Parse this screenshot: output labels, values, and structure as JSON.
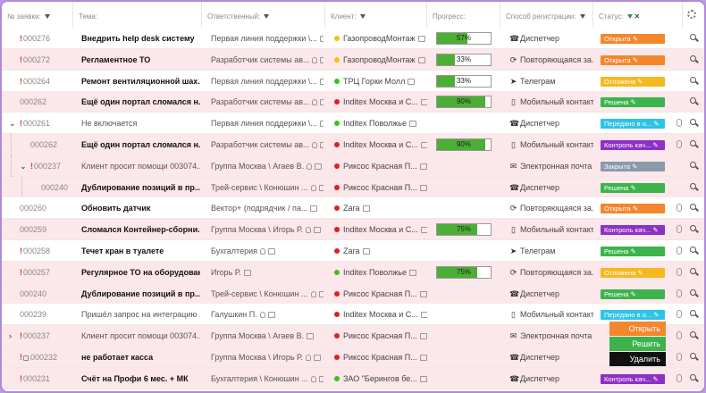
{
  "header": {
    "cols": [
      "№ заявки:",
      "Тема:",
      "Ответственный:",
      "Клиент:",
      "Прогресс:",
      "Способ регистрации:",
      "Статус:"
    ],
    "status_clear_icon": "close-icon"
  },
  "colors": {
    "open": "#f4862e",
    "late": "#f5b820",
    "solved": "#3cb44b",
    "passed": "#2ec3e6",
    "quality": "#8d30c6",
    "closed": "#8a9aab"
  },
  "rows": [
    {
      "num": "000276",
      "excl": "!",
      "topic": "Внедрить help desk систему",
      "resp": "Первая линия поддержки \\...",
      "client": "ГазопроводМонтаж",
      "dot": "#f3c400",
      "progress": 57,
      "progress_label": "57%",
      "reg": "Диспетчер",
      "reg_icon": "phone-icon",
      "status": "Открыта",
      "status_color": "#f4862e",
      "pink": false
    },
    {
      "num": "000272",
      "excl": "!",
      "topic": "Регламентное ТО",
      "resp": "Разработчик системы ав...",
      "client": "ГазопроводМонтаж",
      "dot": "#f3c400",
      "progress": 33,
      "progress_label": "33%",
      "reg": "Повторяющаяся за...",
      "reg_icon": "repeat-icon",
      "status": "Открыта",
      "status_color": "#f4862e",
      "pink": true
    },
    {
      "num": "000264",
      "excl": "!",
      "topic": "Ремонт вентиляционной шах...",
      "resp": "Первая линия поддержки \\...",
      "client": "ТРЦ Горки Молл",
      "dot": "#3cc21c",
      "progress": 33,
      "progress_label": "33%",
      "reg": "Телеграм",
      "reg_icon": "telegram-icon",
      "status": "Отложена",
      "status_color": "#f5b820",
      "pink": false
    },
    {
      "num": "000262",
      "excl": "",
      "topic": "Ещё один портал сломался н...",
      "resp": "Разработчик системы ав...",
      "client": "Inditex Москва и С...",
      "dot": "#e02020",
      "progress": 90,
      "progress_label": "90%",
      "reg": "Мобильный контакт",
      "reg_icon": "mobile-icon",
      "status": "Решена",
      "status_color": "#3cb44b",
      "pink": true
    },
    {
      "num": "000261",
      "excl": "!",
      "topic": "Не включается",
      "resp": "Первая линия поддержки \\...",
      "client": "Inditex Поволжье",
      "dot": "#3cc21c",
      "progress": null,
      "progress_label": "",
      "reg": "Диспетчер",
      "reg_icon": "phone-icon",
      "status": "Передано в о...",
      "status_color": "#2ec3e6",
      "pink": false
    },
    {
      "num": "000262",
      "excl": "",
      "topic": "Ещё один портал сломался н...",
      "resp": "Разработчик системы ав...",
      "client": "Inditex Москва и С...",
      "dot": "#e02020",
      "progress": 90,
      "progress_label": "90%",
      "reg": "Мобильный контакт",
      "reg_icon": "mobile-icon",
      "status": "Контроль кач...",
      "status_color": "#8d30c6",
      "pink": true
    },
    {
      "num": "000237",
      "excl": "!",
      "topic": "Клиент просит помощи 003074...",
      "resp": "Группа Москва \\ Агаев В.",
      "client": "Риксос Красная П...",
      "dot": "#e02020",
      "progress": null,
      "progress_label": "",
      "reg": "Электронная почта",
      "reg_icon": "mail-icon",
      "status": "Закрыта",
      "status_color": "#8a9aab",
      "pink": true
    },
    {
      "num": "000240",
      "excl": "",
      "topic": "Дублирование позиций в пр...",
      "resp": "Трей-сервис \\ Конюшин ...",
      "client": "Риксос Красная П...",
      "dot": "#e02020",
      "progress": null,
      "progress_label": "",
      "reg": "Диспетчер",
      "reg_icon": "phone-icon",
      "status": "Решена",
      "status_color": "#3cb44b",
      "pink": true
    },
    {
      "num": "000260",
      "excl": "",
      "topic": "Обновить датчик",
      "resp": "Вектор+ (подрядчик / па...",
      "client": "Zara",
      "dot": "#e02020",
      "progress": null,
      "progress_label": "",
      "reg": "Повторяющаяся за...",
      "reg_icon": "repeat-icon",
      "status": "Открыта",
      "status_color": "#f4862e",
      "pink": false
    },
    {
      "num": "000259",
      "excl": "",
      "topic": "Сломался Контейнер-сборни...",
      "resp": "Группа Москва \\ Игорь Р.",
      "client": "Inditex Москва и С...",
      "dot": "#e02020",
      "progress": 75,
      "progress_label": "75%",
      "reg": "Мобильный контакт",
      "reg_icon": "mobile-icon",
      "status": "Контроль кач...",
      "status_color": "#8d30c6",
      "pink": true
    },
    {
      "num": "000258",
      "excl": "!",
      "topic": "Течет кран в туалете",
      "resp": "Бухгалтерия",
      "client": "Zara",
      "dot": "#e02020",
      "progress": null,
      "progress_label": "",
      "reg": "Телеграм",
      "reg_icon": "telegram-icon",
      "status": "Решена",
      "status_color": "#3cb44b",
      "pink": false
    },
    {
      "num": "000257",
      "excl": "!",
      "topic": "Регулярное ТО на оборудован...",
      "resp": "Игорь Р.",
      "client": "Inditex Поволжье",
      "dot": "#3cc21c",
      "progress": 75,
      "progress_label": "75%",
      "reg": "Повторяющаяся за...",
      "reg_icon": "repeat-icon",
      "status": "Отложена",
      "status_color": "#f5b820",
      "pink": true
    },
    {
      "num": "000240",
      "excl": "",
      "topic": "Дублирование позиций в пр...",
      "resp": "Трей-сервис \\ Конюшин ...",
      "client": "Риксос Красная П...",
      "dot": "#e02020",
      "progress": null,
      "progress_label": "",
      "reg": "Диспетчер",
      "reg_icon": "phone-icon",
      "status": "Решена",
      "status_color": "#3cb44b",
      "pink": true
    },
    {
      "num": "000239",
      "excl": "",
      "topic": "Пришёл запрос на интеграцию ...",
      "resp": "Галушкин П.",
      "client": "Inditex Москва и С...",
      "dot": "#e02020",
      "progress": null,
      "progress_label": "",
      "reg": "Мобильный контакт",
      "reg_icon": "mobile-icon",
      "status": "Передано в о...",
      "status_color": "#2ec3e6",
      "pink": false
    },
    {
      "num": "000237",
      "excl": "!",
      "topic": "Клиент просит помощи 003074...",
      "resp": "Группа Москва \\ Агаев В.",
      "client": "Риксос Красная П...",
      "dot": "#e02020",
      "progress": null,
      "progress_label": "",
      "reg": "Электронная почта",
      "reg_icon": "mail-icon",
      "status": "",
      "status_color": "#8a9aab",
      "pink": true
    },
    {
      "num": "000232",
      "excl": "!",
      "topic": "не работает касса",
      "resp": "Группа Москва \\ Игорь Р.",
      "client": "Риксос Красная П...",
      "dot": "#e02020",
      "progress": null,
      "progress_label": "",
      "reg": "Диспетчер",
      "reg_icon": "phone-icon",
      "status": "",
      "status_color": "#3cb44b",
      "pink": true
    },
    {
      "num": "000231",
      "excl": "!",
      "topic": "Счёт на Профи 6 мес. + МК",
      "resp": "Бухгалтерия \\ Конюшин ...",
      "client": "ЗАО \"Берингов бе...",
      "dot": "#3cc21c",
      "progress": null,
      "progress_label": "",
      "reg": "Диспетчер",
      "reg_icon": "phone-icon",
      "status": "Контроль кач...",
      "status_color": "#8d30c6",
      "pink": true
    }
  ],
  "context_menu": [
    {
      "label": "Открыть",
      "color": "#f4862e"
    },
    {
      "label": "Решить",
      "color": "#3cb44b"
    },
    {
      "label": "Удалить",
      "color": "#111111"
    }
  ]
}
